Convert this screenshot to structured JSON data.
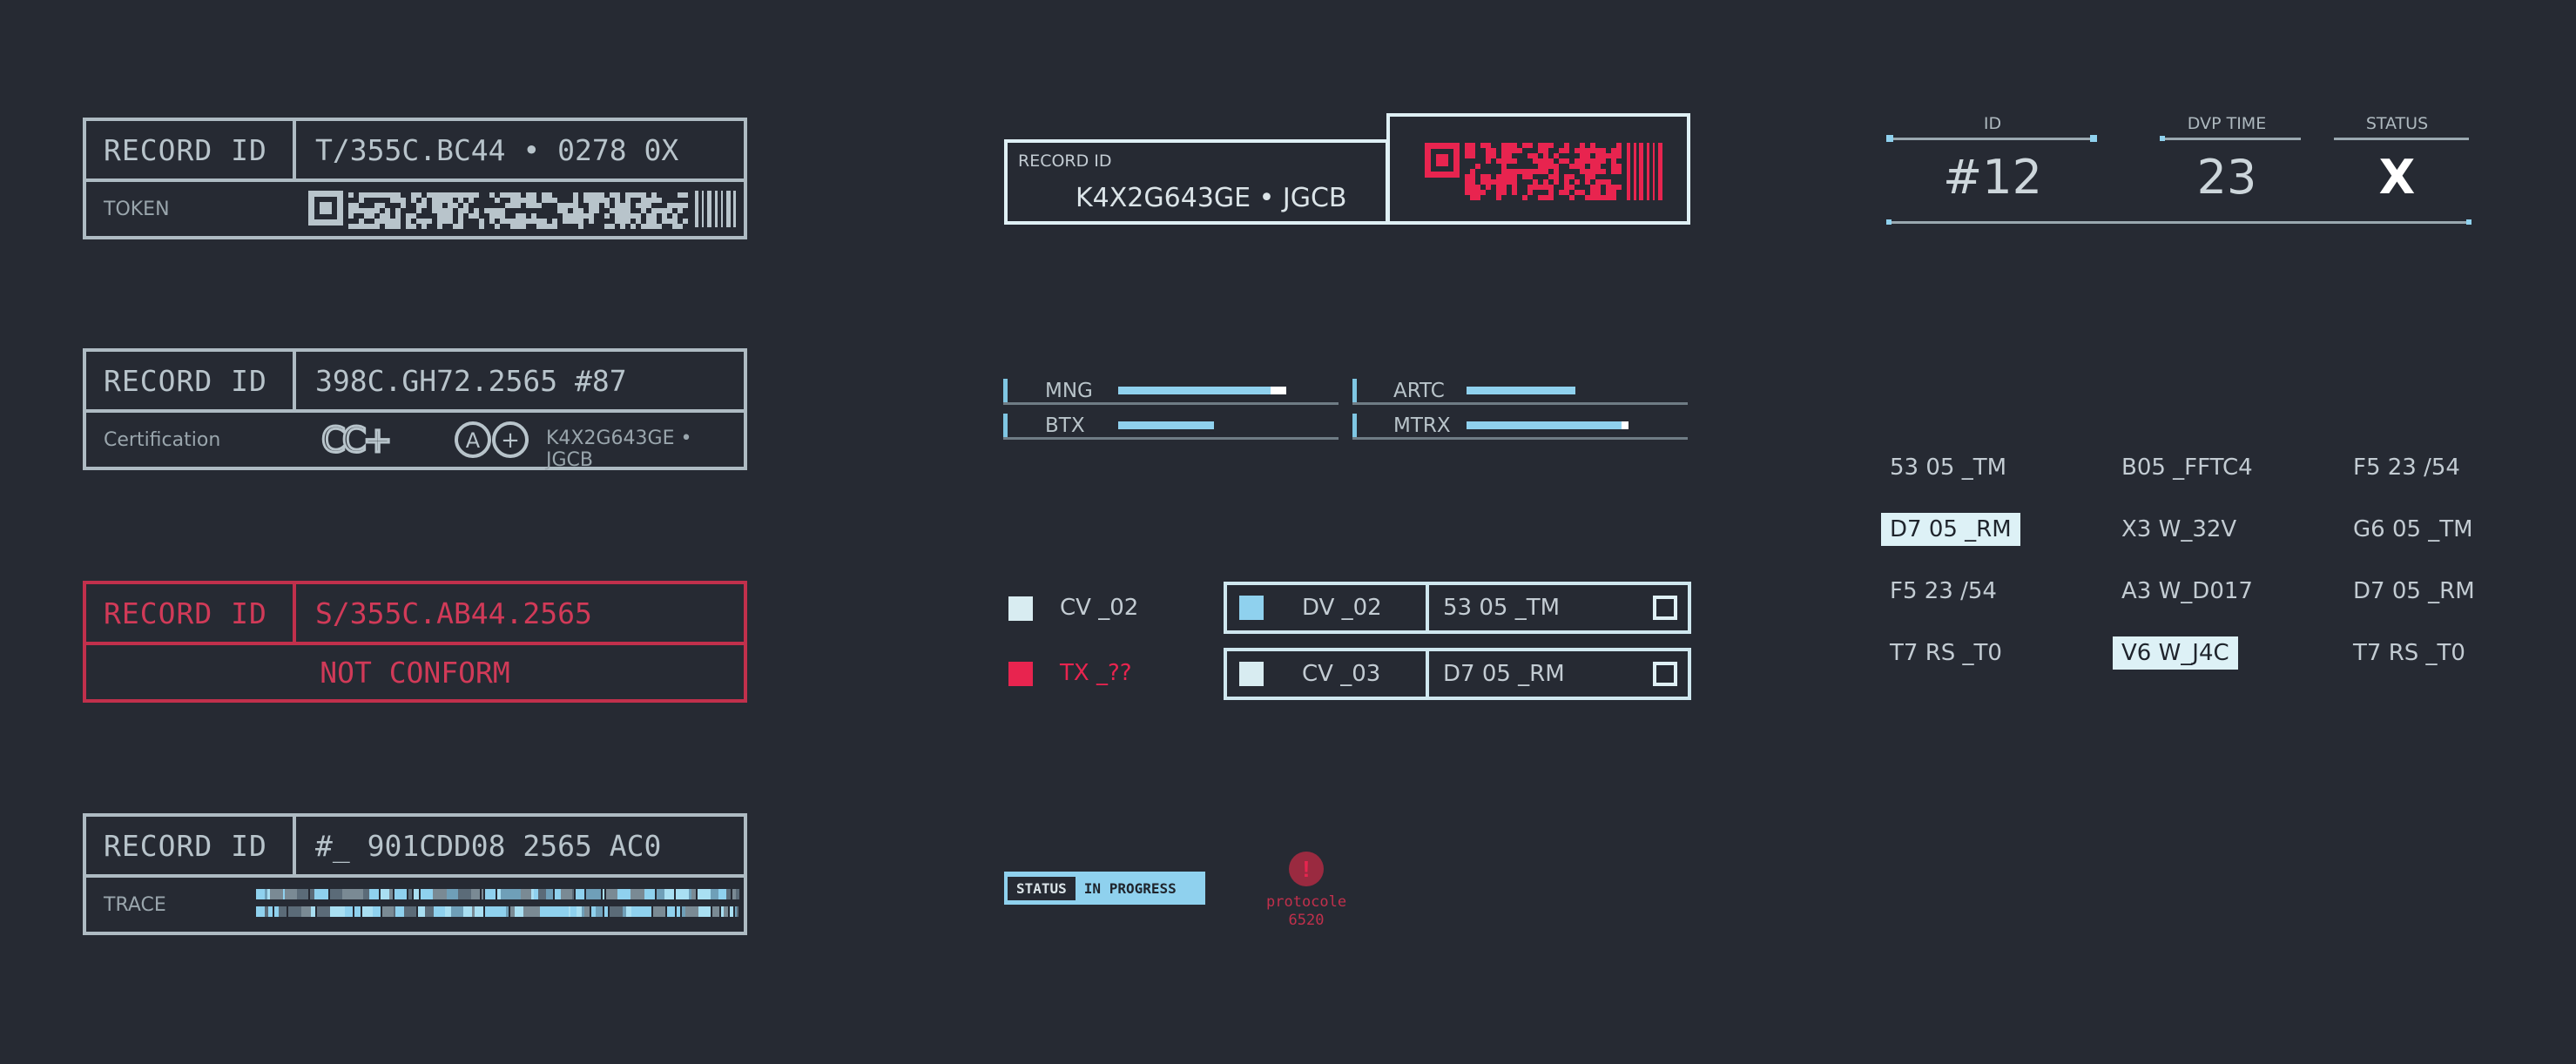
{
  "records": [
    {
      "label": "RECORD ID",
      "value": "T/355C.BC44 • 0278 0X",
      "sub": "TOKEN"
    },
    {
      "label": "RECORD ID",
      "value": "398C.GH72.2565 #87",
      "sub": "Certification",
      "cert_text": "K4X2G643GE • JGCB",
      "cert_logo": "CC+",
      "cert_badge_a": "A",
      "cert_badge_plus": "+"
    },
    {
      "label": "RECORD ID",
      "value": "S/355C.AB44.2565",
      "sub": "NOT CONFORM"
    },
    {
      "label": "RECORD ID",
      "value": "#_ 901CDD08 2565 AC0",
      "sub": "TRACE"
    }
  ],
  "panel": {
    "label": "RECORD ID",
    "value": "K4X2G643GE • JGCB"
  },
  "meters": [
    {
      "label": "MNG",
      "level": 0.52
    },
    {
      "label": "ARTC",
      "level": 0.35
    },
    {
      "label": "BTX",
      "level": 0.3
    },
    {
      "label": "MTRX",
      "level": 0.52
    }
  ],
  "legend": [
    {
      "label": "CV _02",
      "color": "#d8ecf1"
    },
    {
      "label": "TX _??",
      "color": "#e8244f"
    }
  ],
  "box_rows": [
    {
      "a": "DV _02",
      "b": "53 05 _TM",
      "swatch": "#8fd1ee"
    },
    {
      "a": "CV _03",
      "b": "D7 05 _RM",
      "swatch": "#d8ecf1"
    }
  ],
  "status": {
    "label": "STATUS",
    "value": "IN PROGRESS"
  },
  "alert": {
    "icon": "!",
    "line1": "protocole",
    "line2": "6520"
  },
  "stats": [
    {
      "label": "ID",
      "value": "#12"
    },
    {
      "label": "DVP TIME",
      "value": "23"
    },
    {
      "label": "STATUS",
      "value": "X"
    }
  ],
  "grid": [
    [
      "53 05 _TM",
      "B05 _FFTC4",
      "F5 23 /54"
    ],
    [
      "D7 05 _RM",
      "X3 W_32V",
      "G6 05 _TM"
    ],
    [
      "F5 23 /54",
      "A3 W_D017",
      "D7 05 _RM"
    ],
    [
      "T7 RS _T0",
      "V6 W_J4C",
      "T7 RS _T0"
    ]
  ],
  "colors": {
    "bg": "#262a33",
    "accent_red": "#e8244f",
    "accent_blue": "#8fd1ee",
    "line": "#aebbc3"
  }
}
